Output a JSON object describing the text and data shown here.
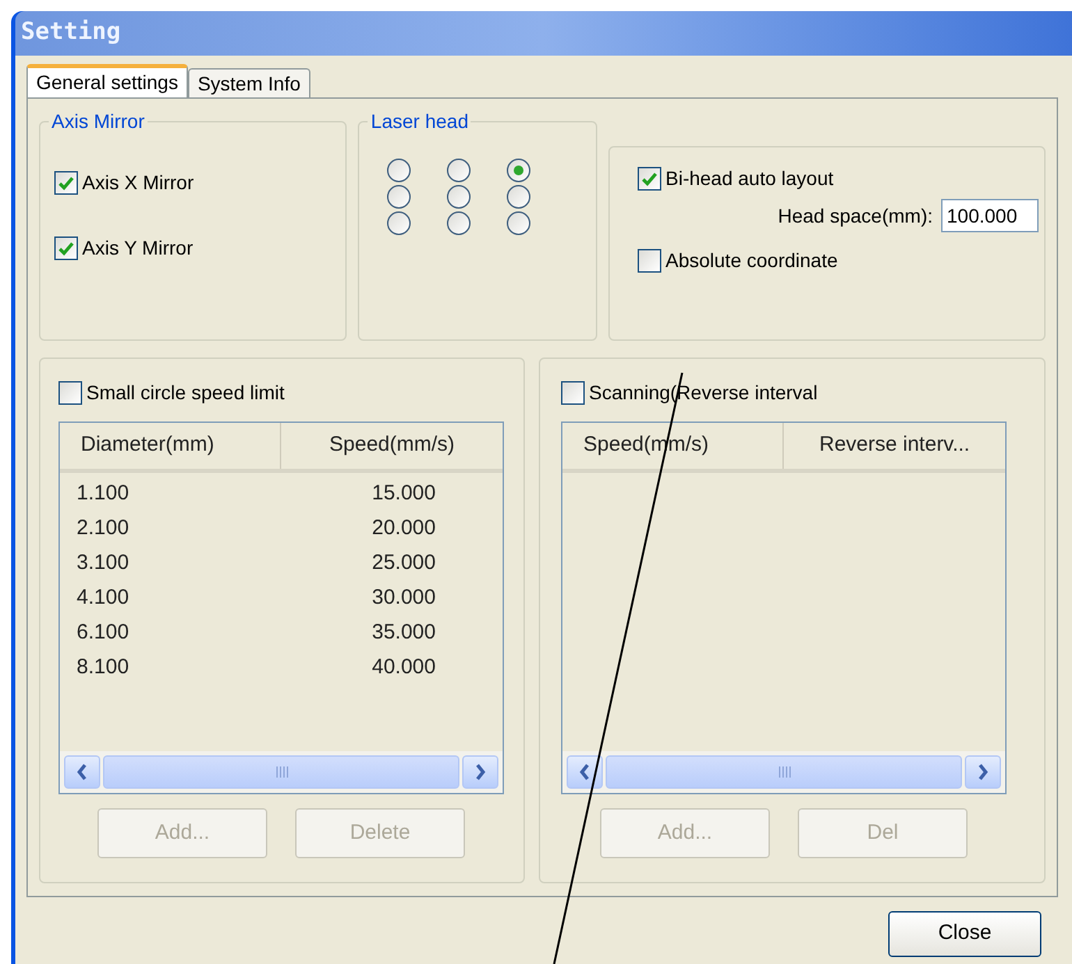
{
  "window": {
    "title": "Setting"
  },
  "tabs": [
    {
      "label": "General settings",
      "selected": true
    },
    {
      "label": "System Info",
      "selected": false
    }
  ],
  "axis_mirror": {
    "title": "Axis Mirror",
    "options": [
      {
        "label": "Axis X Mirror",
        "checked": true
      },
      {
        "label": "Axis Y Mirror",
        "checked": true
      }
    ]
  },
  "laser_head": {
    "title": "Laser head",
    "radios": [
      {
        "selected": false
      },
      {
        "selected": false
      },
      {
        "selected": true
      },
      {
        "selected": false
      },
      {
        "selected": false
      },
      {
        "selected": false
      },
      {
        "selected": false
      },
      {
        "selected": false
      },
      {
        "selected": false
      }
    ]
  },
  "layout": {
    "bi_head": {
      "label": "Bi-head auto layout",
      "checked": true
    },
    "head_space": {
      "label": "Head space(mm):",
      "value": "100.000"
    },
    "absolute": {
      "label": "Absolute coordinate",
      "checked": false
    }
  },
  "small_circle": {
    "checkbox": {
      "label": "Small circle speed limit",
      "checked": false
    },
    "columns": [
      "Diameter(mm)",
      "Speed(mm/s)"
    ],
    "rows": [
      [
        "1.100",
        "15.000"
      ],
      [
        "2.100",
        "20.000"
      ],
      [
        "3.100",
        "25.000"
      ],
      [
        "4.100",
        "30.000"
      ],
      [
        "6.100",
        "35.000"
      ],
      [
        "8.100",
        "40.000"
      ]
    ],
    "buttons": [
      {
        "label": "Add...",
        "disabled": true
      },
      {
        "label": "Delete",
        "disabled": true
      }
    ]
  },
  "scanning": {
    "checkbox": {
      "label": "Scanning(Reverse interval",
      "checked": false
    },
    "columns": [
      "Speed(mm/s)",
      "Reverse interv..."
    ],
    "buttons": [
      {
        "label": "Add...",
        "disabled": true
      },
      {
        "label": "Del",
        "disabled": true
      }
    ]
  },
  "close_button": {
    "label": "Close"
  }
}
